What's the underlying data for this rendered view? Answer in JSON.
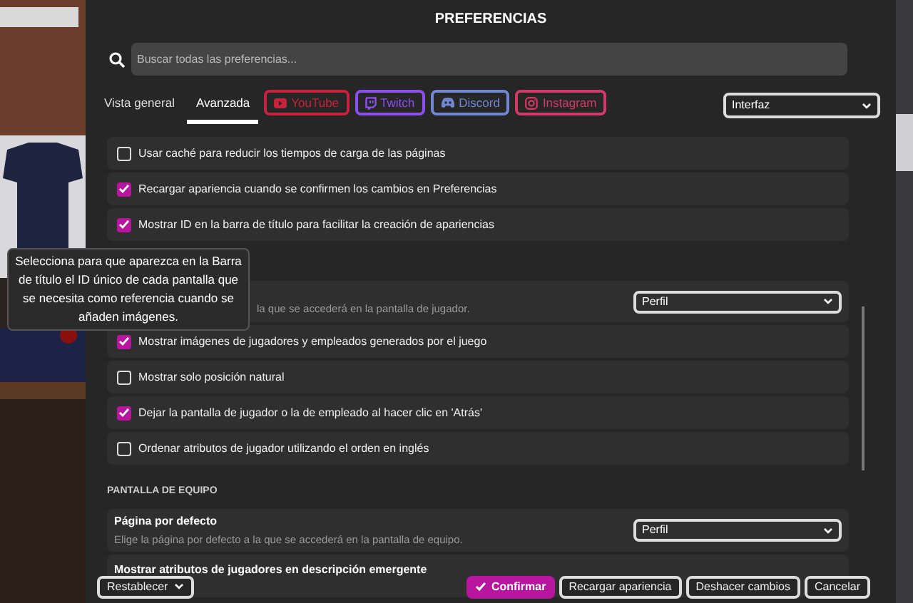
{
  "window": {
    "title": "PREFERENCIAS"
  },
  "search": {
    "placeholder": "Buscar todas las preferencias..."
  },
  "tabs": [
    {
      "label": "Vista general",
      "selected": false
    },
    {
      "label": "Avanzada",
      "selected": true
    }
  ],
  "social_links": [
    {
      "label": "YouTube",
      "kind": "youtube",
      "color": "#c8213c"
    },
    {
      "label": "Twitch",
      "kind": "twitch",
      "color": "#8d4ef0"
    },
    {
      "label": "Discord",
      "kind": "discord",
      "color": "#7087d4"
    },
    {
      "label": "Instagram",
      "kind": "instagram",
      "color": "#d2386a"
    }
  ],
  "category": {
    "value": "Interfaz"
  },
  "items": [
    {
      "kind": "checkbox",
      "label": "Usar caché para reducir los tiempos de carga de las páginas",
      "checked": false
    },
    {
      "kind": "checkbox",
      "label": "Recargar apariencia cuando se confirmen los cambios en Preferencias",
      "checked": true
    },
    {
      "kind": "checkbox",
      "label": "Mostrar ID en la barra de título para facilitar la creación de apariencias",
      "checked": true
    },
    {
      "kind": "select",
      "description": "la que se accederá en la pantalla de jugador.",
      "value": "Perfil"
    },
    {
      "kind": "checkbox",
      "label": "Mostrar imágenes de jugadores y empleados generados por el juego",
      "checked": true
    },
    {
      "kind": "checkbox",
      "label": "Mostrar solo posición natural",
      "checked": false
    },
    {
      "kind": "checkbox",
      "label": "Dejar la pantalla de jugador o la de empleado al hacer clic en 'Atrás'",
      "checked": true
    },
    {
      "kind": "checkbox",
      "label": "Ordenar atributos de jugador utilizando el orden en inglés",
      "checked": false
    },
    {
      "kind": "heading",
      "label": "PANTALLA DE EQUIPO"
    },
    {
      "kind": "select",
      "title": "Página por defecto",
      "description": "Elige la página por defecto a la que se accederá en la pantalla de equipo.",
      "value": "Perfil"
    },
    {
      "kind": "select",
      "title": "Mostrar atributos de jugadores en descripción emergente"
    }
  ],
  "tooltip": {
    "text": "Selecciona para que aparezca en la Barra de título el ID único de cada pantalla que se necesita como referencia cuando se añaden imágenes."
  },
  "footer_buttons": [
    {
      "label": "Restablecer",
      "kind": "menu"
    },
    {
      "label": "Confirmar",
      "kind": "primary"
    },
    {
      "label": "Recargar apariencia",
      "kind": "outline"
    },
    {
      "label": "Deshacer cambios",
      "kind": "outline"
    },
    {
      "label": "Cancelar",
      "kind": "outline"
    }
  ]
}
